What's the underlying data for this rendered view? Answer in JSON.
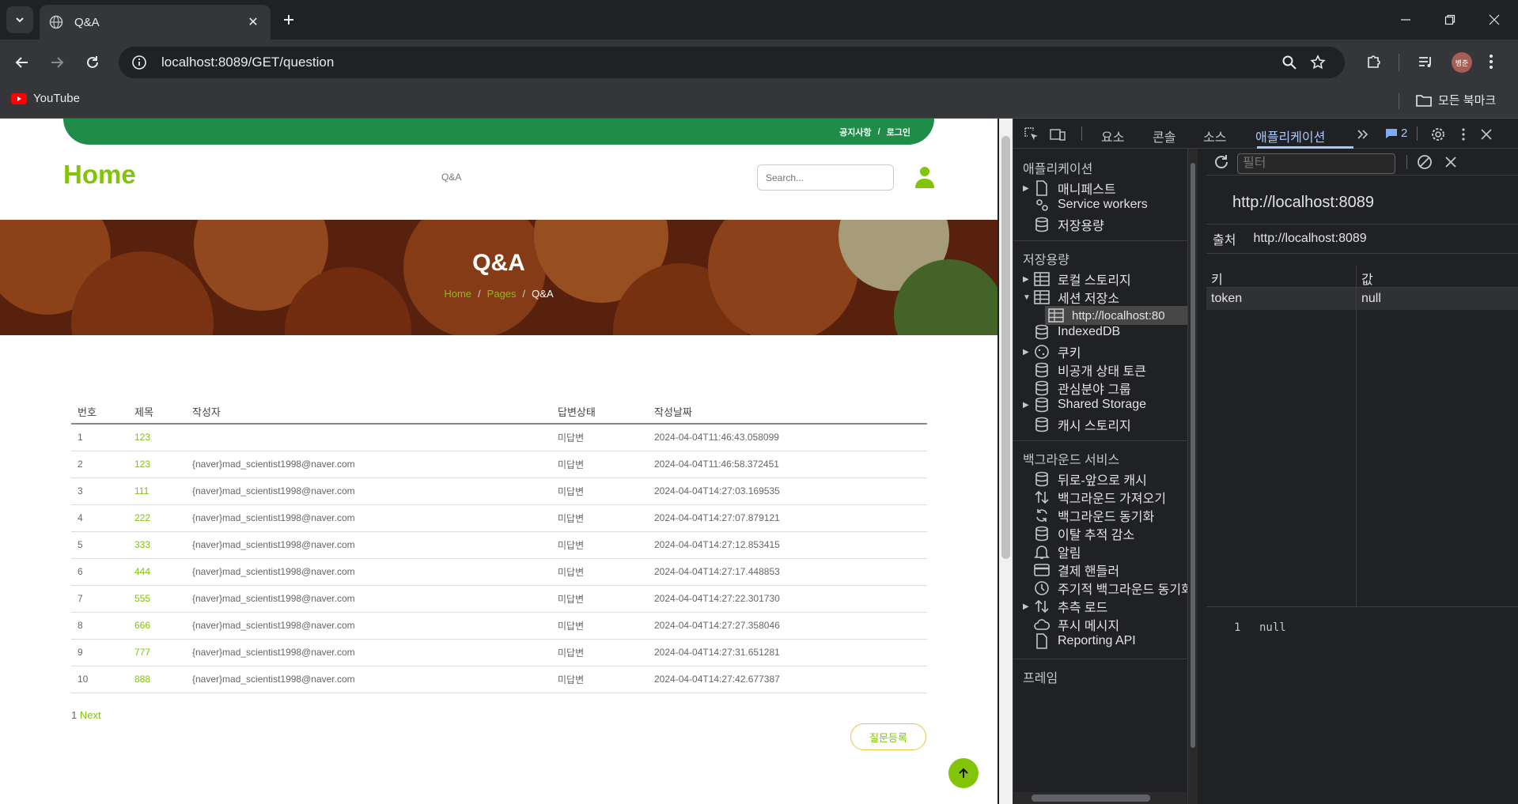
{
  "browser": {
    "tab_title": "Q&A",
    "url": "localhost:8089/GET/question",
    "bookmark_youtube": "YouTube",
    "bookmark_all": "모든 북마크",
    "profile_initials": "병준"
  },
  "site": {
    "topbar_notice": "공지사항",
    "topbar_sep": "/",
    "topbar_login": "로그인",
    "title": "Home",
    "nav_qa": "Q&A",
    "search_placeholder": "Search...",
    "hero_title": "Q&A",
    "crumb_home": "Home",
    "crumb_pages": "Pages",
    "crumb_current": "Q&A",
    "crumb_sep": "/"
  },
  "table": {
    "headers": [
      "번호",
      "제목",
      "작성자",
      "답변상태",
      "작성날짜"
    ],
    "rows": [
      [
        "1",
        "123",
        "",
        "미답변",
        "2024-04-04T11:46:43.058099"
      ],
      [
        "2",
        "123",
        "{naver}mad_scientist1998@naver.com",
        "미답변",
        "2024-04-04T11:46:58.372451"
      ],
      [
        "3",
        "111",
        "{naver}mad_scientist1998@naver.com",
        "미답변",
        "2024-04-04T14:27:03.169535"
      ],
      [
        "4",
        "222",
        "{naver}mad_scientist1998@naver.com",
        "미답변",
        "2024-04-04T14:27:07.879121"
      ],
      [
        "5",
        "333",
        "{naver}mad_scientist1998@naver.com",
        "미답변",
        "2024-04-04T14:27:12.853415"
      ],
      [
        "6",
        "444",
        "{naver}mad_scientist1998@naver.com",
        "미답변",
        "2024-04-04T14:27:17.448853"
      ],
      [
        "7",
        "555",
        "{naver}mad_scientist1998@naver.com",
        "미답변",
        "2024-04-04T14:27:22.301730"
      ],
      [
        "8",
        "666",
        "{naver}mad_scientist1998@naver.com",
        "미답변",
        "2024-04-04T14:27:27.358046"
      ],
      [
        "9",
        "777",
        "{naver}mad_scientist1998@naver.com",
        "미답변",
        "2024-04-04T14:27:31.651281"
      ],
      [
        "10",
        "888",
        "{naver}mad_scientist1998@naver.com",
        "미답변",
        "2024-04-04T14:27:42.677387"
      ]
    ],
    "pager_page": "1",
    "pager_next": "Next",
    "register_button": "질문등록"
  },
  "devtools": {
    "tabs": [
      "요소",
      "콘솔",
      "소스",
      "애플리케이션"
    ],
    "issue_count": "2",
    "sections": {
      "application": "애플리케이션",
      "storage": "저장용량",
      "background": "백그라운드 서비스",
      "frames": "프레임"
    },
    "app_items": [
      "매니페스트",
      "Service workers",
      "저장용량"
    ],
    "storage_items": [
      "로컬 스토리지",
      "세션 저장소",
      "http://localhost:80",
      "IndexedDB",
      "쿠키",
      "비공개 상태 토큰",
      "관심분야 그룹",
      "Shared Storage",
      "캐시 스토리지"
    ],
    "bg_items": [
      "뒤로-앞으로 캐시",
      "백그라운드 가져오기",
      "백그라운드 동기화",
      "이탈 추적 감소",
      "알림",
      "결제 핸들러",
      "주기적 백그라운드 동기화",
      "추측 로드",
      "푸시 메시지",
      "Reporting API"
    ],
    "filter_placeholder": "필터",
    "origin_title": "http://localhost:8089",
    "origin_label": "출처",
    "origin_value": "http://localhost:8089",
    "key_header": "키",
    "value_header": "값",
    "entry_key": "token",
    "entry_value": "null",
    "preview_line": "1",
    "preview_value": "null"
  },
  "colors": {
    "accent_green": "#81c408",
    "topbar_green": "#1f8c4a",
    "devtools_blue": "#a8c7fa"
  }
}
